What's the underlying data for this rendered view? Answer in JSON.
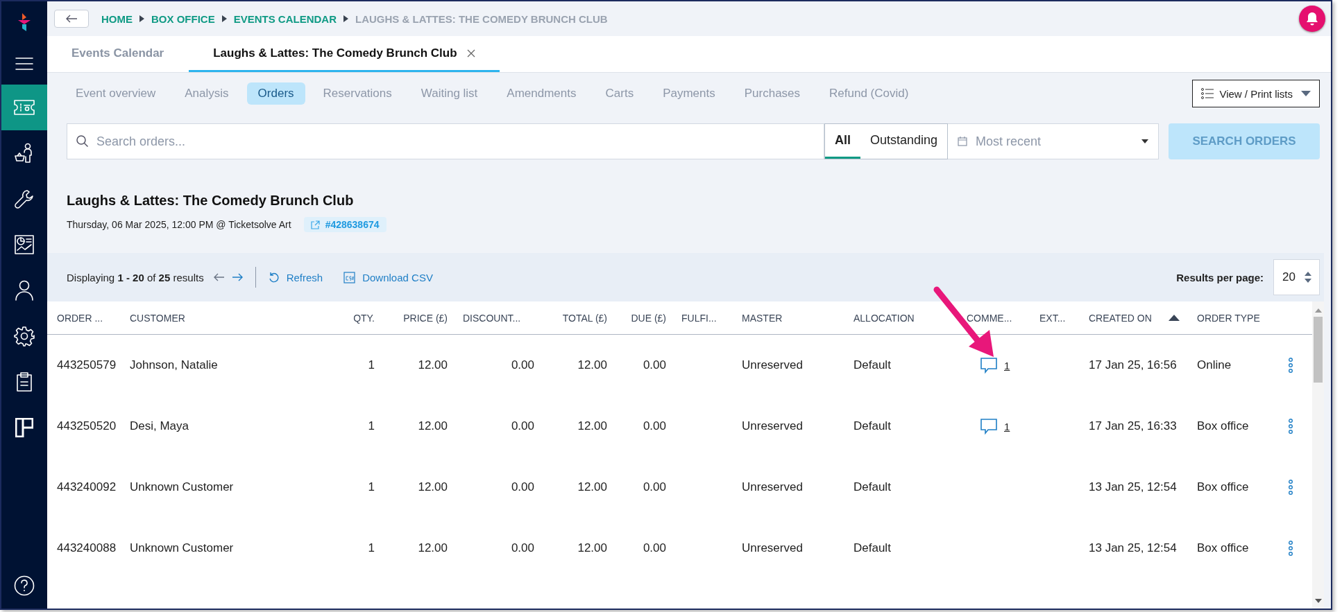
{
  "sidebar": {
    "items": [
      {
        "kind": "logo",
        "selected": false
      },
      {
        "kind": "menu",
        "selected": false
      },
      {
        "kind": "ticket",
        "selected": true
      },
      {
        "kind": "basket-person",
        "selected": false
      },
      {
        "kind": "wrench",
        "selected": false
      },
      {
        "kind": "report",
        "selected": false
      },
      {
        "kind": "person",
        "selected": false
      },
      {
        "kind": "gear",
        "selected": false
      },
      {
        "kind": "clipboard",
        "selected": false
      },
      {
        "kind": "board",
        "selected": false
      }
    ],
    "help": {
      "kind": "help"
    }
  },
  "breadcrumb": [
    {
      "label": "HOME",
      "current": false
    },
    {
      "label": "BOX OFFICE",
      "current": false
    },
    {
      "label": "EVENTS CALENDAR",
      "current": false
    },
    {
      "label": "LAUGHS & LATTES: THE COMEDY BRUNCH CLUB",
      "current": true
    }
  ],
  "tabs": [
    {
      "label": "Events Calendar",
      "selected": false,
      "closable": false
    },
    {
      "label": "Laughs & Lattes: The Comedy Brunch Club",
      "selected": true,
      "closable": true
    }
  ],
  "subnav": [
    {
      "label": "Event overview",
      "selected": false
    },
    {
      "label": "Analysis",
      "selected": false
    },
    {
      "label": "Orders",
      "selected": true
    },
    {
      "label": "Reservations",
      "selected": false
    },
    {
      "label": "Waiting list",
      "selected": false
    },
    {
      "label": "Amendments",
      "selected": false
    },
    {
      "label": "Carts",
      "selected": false
    },
    {
      "label": "Payments",
      "selected": false
    },
    {
      "label": "Purchases",
      "selected": false
    },
    {
      "label": "Refund (Covid)",
      "selected": false
    }
  ],
  "print_button": {
    "label": "View / Print lists"
  },
  "search": {
    "placeholder": "Search orders...",
    "filters": [
      {
        "label": "All",
        "selected": true
      },
      {
        "label": "Outstanding",
        "selected": false
      }
    ],
    "date_select": {
      "placeholder": "Most recent"
    },
    "button": {
      "label": "SEARCH ORDERS",
      "disabled": true
    }
  },
  "event": {
    "title": "Laughs & Lattes: The Comedy Brunch Club",
    "subtitle": "Thursday, 06 Mar 2025, 12:00 PM @ Ticketsolve Art",
    "event_id": "#428638674"
  },
  "toolbar": {
    "displaying": "Displaying **1 - 20** of **25** results",
    "refresh": "Refresh",
    "download": "Download CSV",
    "results_label": "Results per page:",
    "results_value": "20"
  },
  "table": {
    "columns": [
      {
        "label": "ORDER ...",
        "sorted": false
      },
      {
        "label": "CUSTOMER",
        "sorted": false
      },
      {
        "label": "QTY.",
        "sorted": false
      },
      {
        "label": "PRICE (£)",
        "sorted": false
      },
      {
        "label": "DISCOUNT...",
        "sorted": false
      },
      {
        "label": "TOTAL (£)",
        "sorted": false
      },
      {
        "label": "DUE (£)",
        "sorted": false
      },
      {
        "label": "FULFI...",
        "sorted": false
      },
      {
        "label": "MASTER",
        "sorted": false
      },
      {
        "label": "ALLOCATION",
        "sorted": false
      },
      {
        "label": "COMME...",
        "sorted": false
      },
      {
        "label": "EXT...",
        "sorted": false
      },
      {
        "label": "CREATED ON",
        "sorted": true
      },
      {
        "label": "ORDER TYPE",
        "sorted": false
      }
    ],
    "rows": [
      {
        "order": "443250579",
        "customer": "Johnson, Natalie",
        "qty": "1",
        "price": "12.00",
        "discount": "0.00",
        "total": "12.00",
        "due": "0.00",
        "master": "Unreserved",
        "allocation": "Default",
        "comments": "1",
        "created": "17 Jan 25, 16:56",
        "type": "Online"
      },
      {
        "order": "443250520",
        "customer": "Desi, Maya",
        "qty": "1",
        "price": "12.00",
        "discount": "0.00",
        "total": "12.00",
        "due": "0.00",
        "master": "Unreserved",
        "allocation": "Default",
        "comments": "1",
        "created": "17 Jan 25, 16:33",
        "type": "Box office"
      },
      {
        "order": "443240092",
        "customer": "Unknown Customer",
        "qty": "1",
        "price": "12.00",
        "discount": "0.00",
        "total": "12.00",
        "due": "0.00",
        "master": "Unreserved",
        "allocation": "Default",
        "created": "13 Jan 25, 12:54",
        "type": "Box office"
      },
      {
        "order": "443240088",
        "customer": "Unknown Customer",
        "qty": "1",
        "price": "12.00",
        "discount": "0.00",
        "total": "12.00",
        "due": "0.00",
        "master": "Unreserved",
        "allocation": "Default",
        "created": "13 Jan 25, 12:54",
        "type": "Box office"
      }
    ]
  }
}
